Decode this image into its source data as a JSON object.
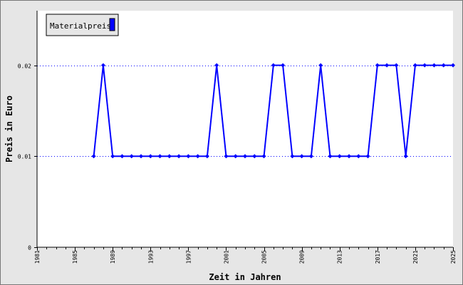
{
  "chart_data": {
    "type": "line",
    "xlabel": "Zeit in Jahren",
    "ylabel": "Preis in Euro",
    "xlim": [
      1981,
      2025
    ],
    "ylim": [
      0,
      0.026
    ],
    "x_ticks": [
      "1981",
      "1985",
      "1989",
      "1993",
      "1997",
      "2001",
      "2005",
      "2009",
      "2013",
      "2017",
      "2021",
      "2025"
    ],
    "y_ticks": [
      "0",
      "0.01",
      "0.02"
    ],
    "grid": "dotted horizontal lines at y ticks",
    "legend": "top-left",
    "series": [
      {
        "name": "Materialpreis",
        "color": "#0000ff",
        "x": [
          1987,
          1988,
          1989,
          1990,
          1991,
          1992,
          1993,
          1994,
          1995,
          1996,
          1997,
          1998,
          1999,
          2000,
          2001,
          2002,
          2003,
          2004,
          2005,
          2006,
          2007,
          2008,
          2009,
          2010,
          2011,
          2012,
          2013,
          2014,
          2015,
          2016,
          2017,
          2018,
          2019,
          2020,
          2021,
          2022,
          2023,
          2024,
          2025
        ],
        "values": [
          0.01,
          0.02,
          0.01,
          0.01,
          0.01,
          0.01,
          0.01,
          0.01,
          0.01,
          0.01,
          0.01,
          0.01,
          0.01,
          0.02,
          0.01,
          0.01,
          0.01,
          0.01,
          0.01,
          0.02,
          0.02,
          0.01,
          0.01,
          0.01,
          0.02,
          0.01,
          0.01,
          0.01,
          0.01,
          0.01,
          0.02,
          0.02,
          0.02,
          0.01,
          0.02,
          0.02,
          0.02,
          0.02,
          0.02
        ]
      }
    ]
  },
  "colors": {
    "background": "#e6e6e6",
    "plot_background": "#ffffff",
    "series": "#0000ff",
    "grid": "#0000ff",
    "frame": "#000000"
  }
}
